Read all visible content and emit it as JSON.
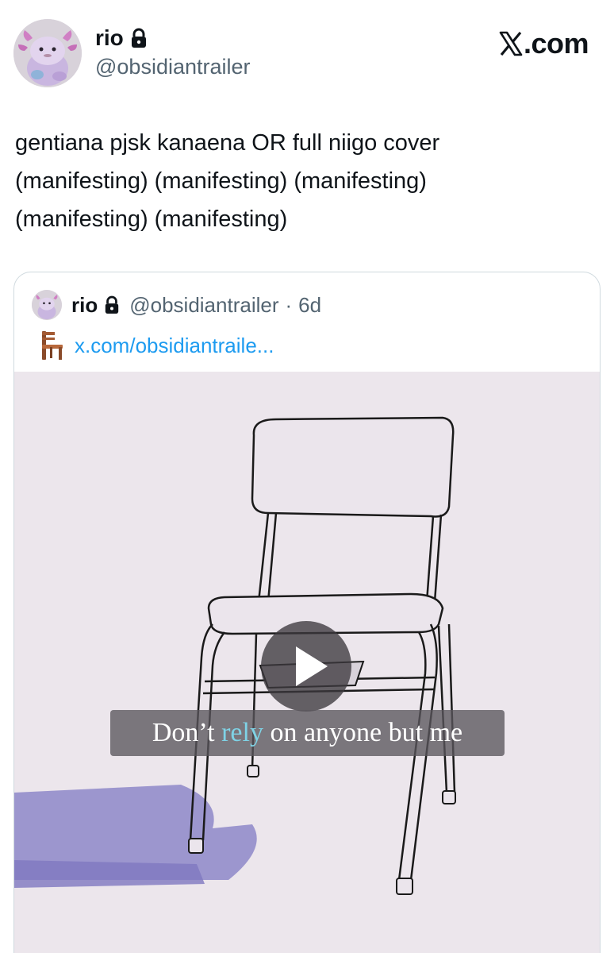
{
  "site_label": "X.com",
  "author": {
    "display_name": "rio",
    "handle": "@obsidiantrailer",
    "protected": true
  },
  "tweet": {
    "text_lines": [
      "gentiana pjsk kanaena OR full niigo cover",
      "(manifesting) (manifesting) (manifesting)",
      "(manifesting) (manifesting)"
    ]
  },
  "quoted_tweet": {
    "display_name": "rio",
    "handle": "@obsidiantrailer",
    "separator": "·",
    "time": "6d",
    "link_emoji": "chair",
    "link_text": "x.com/obsidiantraile...",
    "media": {
      "type": "video",
      "caption_before": "Don’t ",
      "caption_highlight": "rely",
      "caption_after": " on anyone but me",
      "caption_highlight_color": "#7fd3e6"
    }
  },
  "colors": {
    "link": "#1d9bf0",
    "secondary_text": "#536471",
    "media_background": "#ece6ec",
    "shadow": "#8e87c9"
  }
}
